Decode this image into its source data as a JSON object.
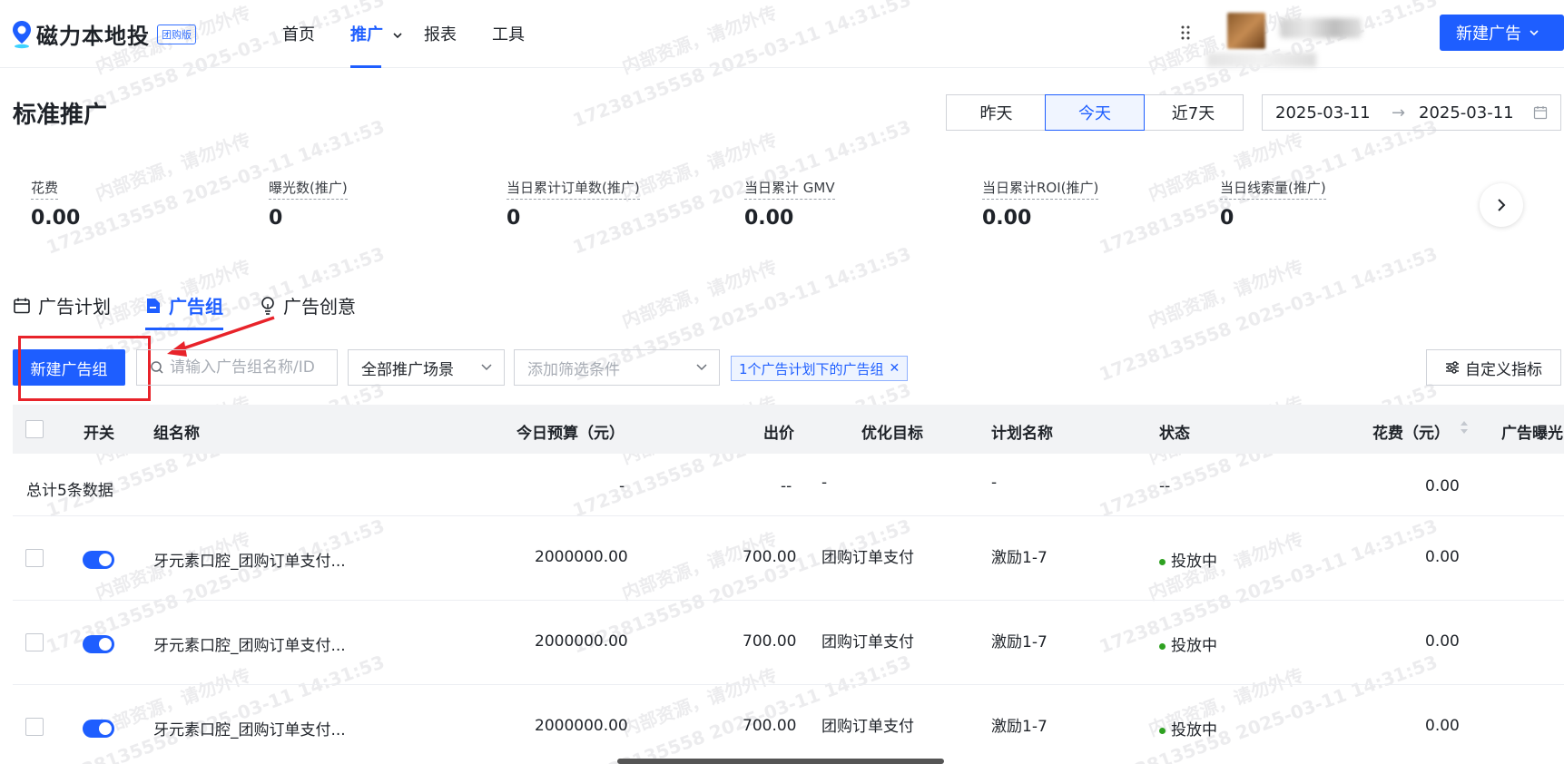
{
  "brand": {
    "name": "磁力本地投",
    "badge": "团购版",
    "accent": "#1e5eff"
  },
  "nav": {
    "items": [
      "首页",
      "推广",
      "报表",
      "工具"
    ],
    "active": "推广"
  },
  "header": {
    "new_ad_label": "新建广告"
  },
  "page": {
    "title": "标准推广"
  },
  "date_range": {
    "presets": [
      "昨天",
      "今天",
      "近7天"
    ],
    "active_preset": "今天",
    "start": "2025-03-11",
    "separator": "→",
    "end": "2025-03-11"
  },
  "metrics": [
    {
      "label": "花费",
      "value": "0.00"
    },
    {
      "label": "曝光数(推广)",
      "value": "0"
    },
    {
      "label": "当日累计订单数(推广)",
      "value": "0"
    },
    {
      "label": "当日累计 GMV",
      "value": "0.00"
    },
    {
      "label": "当日累计ROI(推广)",
      "value": "0.00"
    },
    {
      "label": "当日线索量(推广)",
      "value": "0"
    }
  ],
  "tabs": [
    {
      "label": "广告计划",
      "icon": "calendar-icon"
    },
    {
      "label": "广告组",
      "icon": "folder-icon"
    },
    {
      "label": "广告创意",
      "icon": "lightbulb-icon"
    }
  ],
  "active_tab": "广告组",
  "toolbar": {
    "new_group_label": "新建广告组",
    "search_placeholder": "请输入广告组名称/ID",
    "scene_select": "全部推广场景",
    "filter_placeholder": "添加筛选条件",
    "active_filter": "1个广告计划下的广告组",
    "custom_metrics_label": "自定义指标"
  },
  "table": {
    "headers": [
      "开关",
      "组名称",
      "今日预算（元）",
      "出价",
      "优化目标",
      "计划名称",
      "状态",
      "花费（元）",
      "广告曝光"
    ],
    "summary": {
      "label": "总计5条数据",
      "budget": "-",
      "bid": "--",
      "goal": "-",
      "plan": "-",
      "status": "--",
      "spend": "0.00"
    },
    "rows": [
      {
        "name": "牙元素口腔_团购订单支付...",
        "budget": "2000000.00",
        "bid": "700.00",
        "goal": "团购订单支付",
        "plan": "激励1-7",
        "status": "投放中",
        "spend": "0.00",
        "on": true
      },
      {
        "name": "牙元素口腔_团购订单支付...",
        "budget": "2000000.00",
        "bid": "700.00",
        "goal": "团购订单支付",
        "plan": "激励1-7",
        "status": "投放中",
        "spend": "0.00",
        "on": true
      },
      {
        "name": "牙元素口腔_团购订单支付...",
        "budget": "2000000.00",
        "bid": "700.00",
        "goal": "团购订单支付",
        "plan": "激励1-7",
        "status": "投放中",
        "spend": "0.00",
        "on": true
      }
    ]
  },
  "watermark": {
    "line1": "内部资源，请勿外传",
    "line2": "17238135558 2025-03-11 14:31:53"
  }
}
